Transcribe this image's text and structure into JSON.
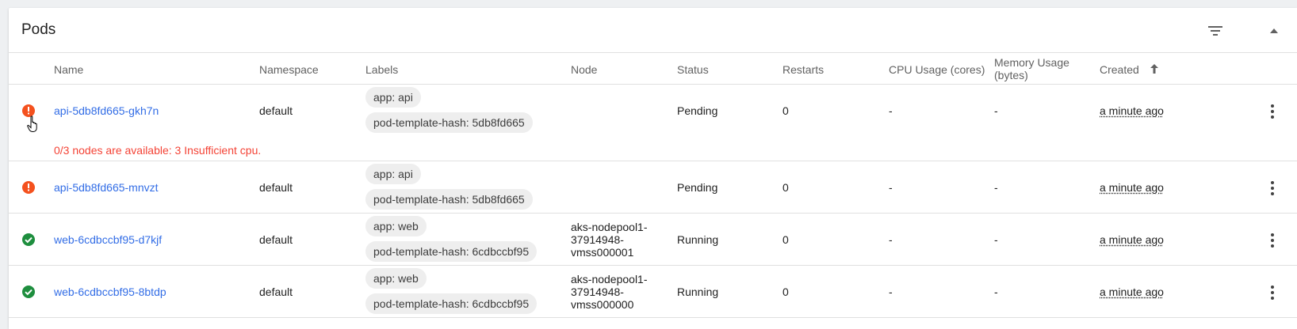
{
  "card": {
    "title": "Pods"
  },
  "columns": {
    "name": "Name",
    "namespace": "Namespace",
    "labels": "Labels",
    "node": "Node",
    "status": "Status",
    "restarts": "Restarts",
    "cpu": "CPU Usage (cores)",
    "memory_line1": "Memory Usage",
    "memory_line2": "(bytes)",
    "created": "Created",
    "created_sort": "ascending"
  },
  "rows": [
    {
      "state": "error",
      "name": "api-5db8fd665-gkh7n",
      "namespace": "default",
      "label1": "app: api",
      "label2": "pod-template-hash: 5db8fd665",
      "node1": "",
      "node2": "",
      "node3": "",
      "status": "Pending",
      "restarts": "0",
      "cpu": "-",
      "memory": "-",
      "created": "a minute ago",
      "message": "0/3 nodes are available: 3 Insufficient cpu."
    },
    {
      "state": "error",
      "name": "api-5db8fd665-mnvzt",
      "namespace": "default",
      "label1": "app: api",
      "label2": "pod-template-hash: 5db8fd665",
      "node1": "",
      "node2": "",
      "node3": "",
      "status": "Pending",
      "restarts": "0",
      "cpu": "-",
      "memory": "-",
      "created": "a minute ago"
    },
    {
      "state": "ok",
      "name": "web-6cdbccbf95-d7kjf",
      "namespace": "default",
      "label1": "app: web",
      "label2": "pod-template-hash: 6cdbccbf95",
      "node1": "aks-nodepool1-",
      "node2": "37914948-",
      "node3": "vmss000001",
      "status": "Running",
      "restarts": "0",
      "cpu": "-",
      "memory": "-",
      "created": "a minute ago"
    },
    {
      "state": "ok",
      "name": "web-6cdbccbf95-8btdp",
      "namespace": "default",
      "label1": "app: web",
      "label2": "pod-template-hash: 6cdbccbf95",
      "node1": "aks-nodepool1-",
      "node2": "37914948-",
      "node3": "vmss000000",
      "status": "Running",
      "restarts": "0",
      "cpu": "-",
      "memory": "-",
      "created": "a minute ago"
    }
  ],
  "colors": {
    "error": "#f4511e",
    "ok": "#1e8e3e",
    "link": "#326de6",
    "error_text": "#f44336"
  }
}
